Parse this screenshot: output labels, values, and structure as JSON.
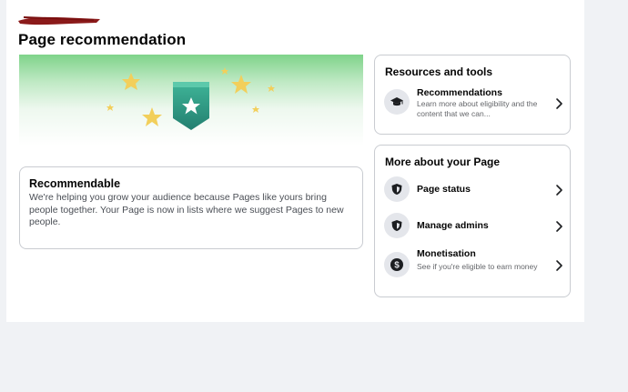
{
  "page": {
    "title": "Page recommendation"
  },
  "recommendable": {
    "title": "Recommendable",
    "text": "We're helping you grow your audience because Pages like yours bring people together. Your Page is now in lists where we suggest Pages to new people."
  },
  "resources": {
    "title": "Resources and tools",
    "items": [
      {
        "label": "Recommendations",
        "description": "Learn more about eligibility and the content that we can...",
        "icon": "graduation-cap-icon"
      }
    ]
  },
  "more": {
    "title": "More about your Page",
    "items": [
      {
        "label": "Page status",
        "icon": "shield-icon"
      },
      {
        "label": "Manage admins",
        "icon": "shield-icon"
      },
      {
        "label": "Monetisation",
        "description": "See if you're eligible to earn money",
        "icon": "dollar-icon"
      }
    ]
  },
  "colors": {
    "banner_green": "#7fd38a",
    "badge_teal": "#2e9c86",
    "star_yellow": "#f2cf5b"
  }
}
